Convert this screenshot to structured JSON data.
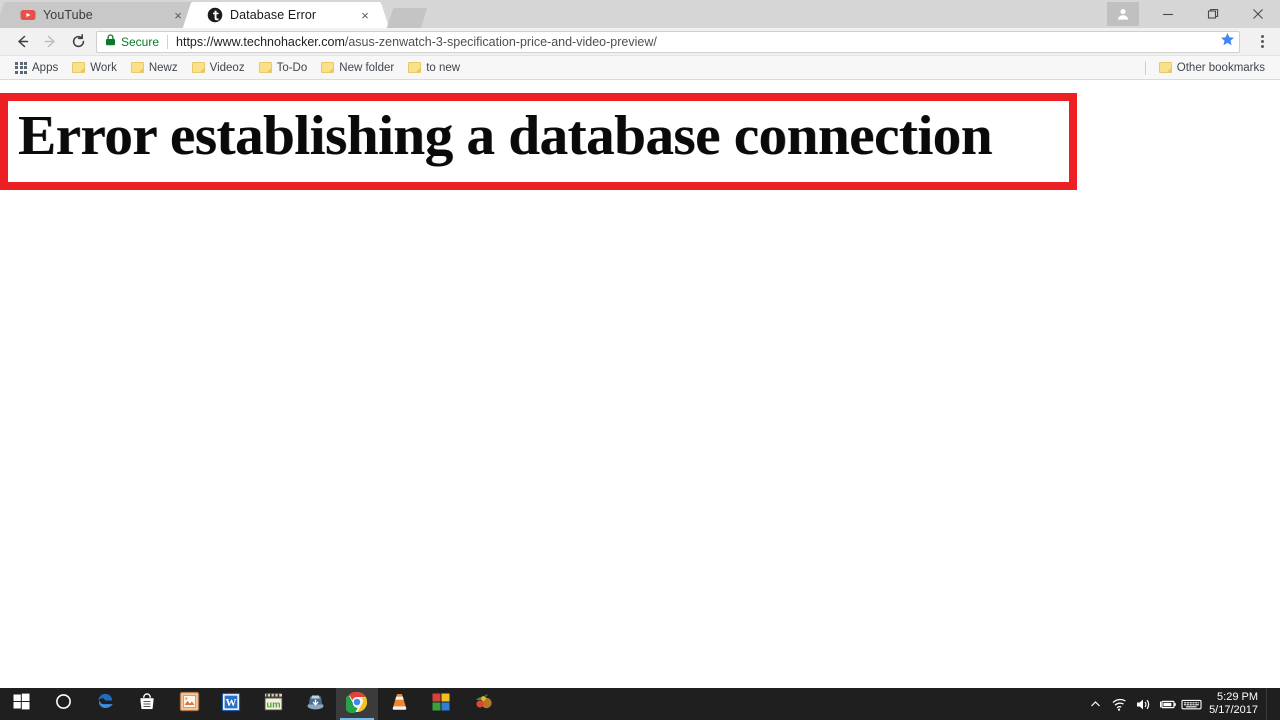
{
  "browser": {
    "tabs": [
      {
        "title": "YouTube",
        "favicon": "youtube-icon",
        "active": false,
        "close_label": "×"
      },
      {
        "title": "Database Error",
        "favicon": "technohacker-icon",
        "active": true,
        "close_label": "×"
      }
    ],
    "new_tab_label": "",
    "window_controls": {
      "avatar_label": "",
      "minimize_label": "–",
      "maximize_label": "❐",
      "close_label": "✕"
    },
    "toolbar": {
      "back_label": "←",
      "forward_label": "→",
      "reload_label": "⟳",
      "security_label": "Secure",
      "url_domain": "https://www.technohacker.com",
      "url_path": "/asus-zenwatch-3-specification-price-and-video-preview/",
      "bookmark_star_label": "★",
      "menu_label": ""
    },
    "bookmarks": {
      "apps_label": "Apps",
      "items": [
        {
          "label": "Work"
        },
        {
          "label": "Newz"
        },
        {
          "label": "Videoz"
        },
        {
          "label": "To-Do"
        },
        {
          "label": "New folder"
        },
        {
          "label": "to new"
        }
      ],
      "other_label": "Other bookmarks"
    }
  },
  "page": {
    "error_heading": "Error establishing a database connection",
    "border_color": "#ec2024"
  },
  "taskbar": {
    "start_label": "",
    "items": [
      {
        "name": "start-button",
        "icon": "windows-logo-icon"
      },
      {
        "name": "cortana-button",
        "icon": "cortana-circle-icon"
      },
      {
        "name": "taskbar-edge",
        "icon": "edge-icon"
      },
      {
        "name": "taskbar-store",
        "icon": "microsoft-store-icon"
      },
      {
        "name": "taskbar-photo-viewer",
        "icon": "photo-frame-icon"
      },
      {
        "name": "taskbar-word",
        "icon": "ms-word-icon"
      },
      {
        "name": "taskbar-utorrent",
        "icon": "utorrent-icon"
      },
      {
        "name": "taskbar-idm",
        "icon": "download-manager-icon"
      },
      {
        "name": "taskbar-chrome",
        "icon": "chrome-icon",
        "active": true
      },
      {
        "name": "taskbar-vlc",
        "icon": "vlc-cone-icon"
      },
      {
        "name": "taskbar-tiles-app",
        "icon": "color-tiles-icon"
      },
      {
        "name": "taskbar-food-app",
        "icon": "fruit-basket-icon"
      }
    ],
    "tray": {
      "overflow_label": "⌃",
      "network_label": "",
      "volume_label": "",
      "battery_label": "",
      "keyboard_label": "",
      "time": "5:29 PM",
      "date": "5/17/2017"
    }
  }
}
